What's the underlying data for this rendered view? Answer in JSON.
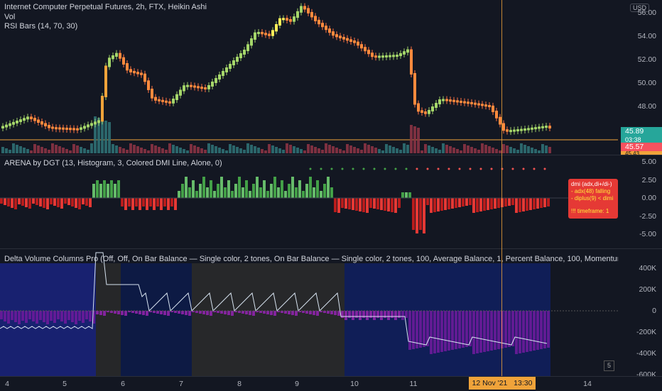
{
  "price_pane": {
    "title": "Internet Computer Perpetual Futures, 2h, FTX, Heikin Ashi",
    "vol_label": "Vol",
    "rsi_label": "RSI Bars (14, 70, 30)",
    "currency": "USD",
    "ticks": [
      "56.00",
      "54.00",
      "52.00",
      "50.00",
      "48.00"
    ],
    "last_price": "45.89",
    "countdown": "03:38",
    "price_line": "45.57",
    "partial_tag": "45.43",
    "colors": {
      "last": "#26a69a",
      "line": "#f7525f",
      "partial": "#f0a33a"
    }
  },
  "arena_pane": {
    "title": "ARENA by DGT (13, Histogram, 3, Colored DMI Line, Alone, 0)",
    "ticks": [
      "5.00",
      "2.50",
      "0.00",
      "-2.50",
      "-5.00"
    ],
    "tooltip": {
      "lines": [
        "dmi (adx,di+/di-)",
        "- adx(48) falling",
        "- diplus(9) < dimi"
      ],
      "footer": "!!! timeframe: 1"
    }
  },
  "delta_pane": {
    "title": "Delta Volume Columns Pro (Off, Off, On Bar Balance — Single color, 2 tones, On Bar Balance — Single color, 2 tones, 100, Average Balance, 1, Percent Balance, 100, Momentum Balance — Dual Co",
    "ticks": [
      "400K",
      "200K",
      "0",
      "-200K",
      "-400K",
      "-600K"
    ],
    "badge": "5"
  },
  "time_axis": {
    "labels": [
      "4",
      "5",
      "6",
      "7",
      "8",
      "9",
      "10",
      "11",
      "14"
    ],
    "crosshair_date": "12 Nov '21",
    "crosshair_time": "13:30"
  }
}
